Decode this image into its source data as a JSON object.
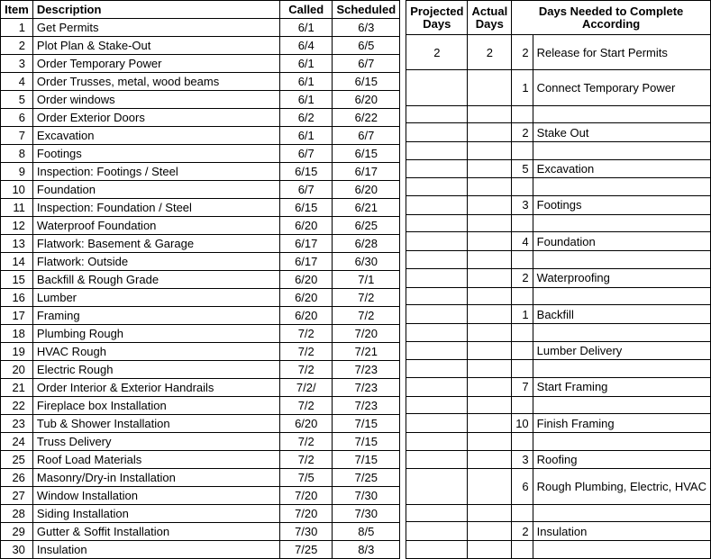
{
  "left": {
    "headers": {
      "item": "Item",
      "desc": "Description",
      "called": "Called",
      "scheduled": "Scheduled"
    },
    "rows": [
      {
        "item": "1",
        "desc": "Get Permits",
        "called": "6/1",
        "scheduled": "6/3"
      },
      {
        "item": "2",
        "desc": "Plot Plan & Stake-Out",
        "called": "6/4",
        "scheduled": "6/5"
      },
      {
        "item": "3",
        "desc": "Order Temporary Power",
        "called": "6/1",
        "scheduled": "6/7"
      },
      {
        "item": "4",
        "desc": "Order Trusses, metal, wood beams",
        "called": "6/1",
        "scheduled": "6/15"
      },
      {
        "item": "5",
        "desc": "Order windows",
        "called": "6/1",
        "scheduled": "6/20"
      },
      {
        "item": "6",
        "desc": "Order Exterior Doors",
        "called": "6/2",
        "scheduled": "6/22"
      },
      {
        "item": "7",
        "desc": "Excavation",
        "called": "6/1",
        "scheduled": "6/7"
      },
      {
        "item": "8",
        "desc": "Footings",
        "called": "6/7",
        "scheduled": "6/15"
      },
      {
        "item": "9",
        "desc": "Inspection: Footings / Steel",
        "called": "6/15",
        "scheduled": "6/17"
      },
      {
        "item": "10",
        "desc": "Foundation",
        "called": "6/7",
        "scheduled": "6/20"
      },
      {
        "item": "11",
        "desc": "Inspection: Foundation / Steel",
        "called": "6/15",
        "scheduled": "6/21"
      },
      {
        "item": "12",
        "desc": "Waterproof Foundation",
        "called": "6/20",
        "scheduled": "6/25"
      },
      {
        "item": "13",
        "desc": "Flatwork: Basement & Garage",
        "called": "6/17",
        "scheduled": "6/28"
      },
      {
        "item": "14",
        "desc": "Flatwork: Outside",
        "called": "6/17",
        "scheduled": "6/30"
      },
      {
        "item": "15",
        "desc": "Backfill & Rough Grade",
        "called": "6/20",
        "scheduled": "7/1"
      },
      {
        "item": "16",
        "desc": "Lumber",
        "called": "6/20",
        "scheduled": "7/2"
      },
      {
        "item": "17",
        "desc": "Framing",
        "called": "6/20",
        "scheduled": "7/2"
      },
      {
        "item": "18",
        "desc": "Plumbing Rough",
        "called": "7/2",
        "scheduled": "7/20"
      },
      {
        "item": "19",
        "desc": "HVAC Rough",
        "called": "7/2",
        "scheduled": "7/21"
      },
      {
        "item": "20",
        "desc": "Electric Rough",
        "called": "7/2",
        "scheduled": "7/23"
      },
      {
        "item": "21",
        "desc": "Order Interior & Exterior Handrails",
        "called": "7/2/",
        "scheduled": "7/23"
      },
      {
        "item": "22",
        "desc": "Fireplace box Installation",
        "called": "7/2",
        "scheduled": "7/23"
      },
      {
        "item": "23",
        "desc": "Tub & Shower Installation",
        "called": "6/20",
        "scheduled": "7/15"
      },
      {
        "item": "24",
        "desc": "Truss Delivery",
        "called": "7/2",
        "scheduled": "7/15"
      },
      {
        "item": "25",
        "desc": "Roof Load Materials",
        "called": "7/2",
        "scheduled": "7/15"
      },
      {
        "item": "26",
        "desc": "Masonry/Dry-in Installation",
        "called": "7/5",
        "scheduled": "7/25"
      },
      {
        "item": "27",
        "desc": "Window Installation",
        "called": "7/20",
        "scheduled": "7/30"
      },
      {
        "item": "28",
        "desc": "Siding Installation",
        "called": "7/20",
        "scheduled": "7/30"
      },
      {
        "item": "29",
        "desc": "Gutter & Soffit Installation",
        "called": "7/30",
        "scheduled": "8/5"
      },
      {
        "item": "30",
        "desc": "Insulation",
        "called": "7/25",
        "scheduled": "8/3"
      }
    ]
  },
  "right": {
    "headers": {
      "projected": "Projected Days",
      "actual": "Actual Days",
      "daysNeeded": "Days Needed to Complete According"
    },
    "rows": [
      {
        "span": 2,
        "proj": "2",
        "actual": "2",
        "daysn": "2",
        "note": "Release for Start Permits"
      },
      {
        "span": 2,
        "proj": "",
        "actual": "",
        "daysn": "1",
        "note": "Connect Temporary Power"
      },
      {
        "span": 1,
        "proj": "",
        "actual": "",
        "daysn": "",
        "note": ""
      },
      {
        "span": 1,
        "proj": "",
        "actual": "",
        "daysn": "2",
        "note": "Stake Out"
      },
      {
        "span": 1,
        "proj": "",
        "actual": "",
        "daysn": "",
        "note": ""
      },
      {
        "span": 1,
        "proj": "",
        "actual": "",
        "daysn": "5",
        "note": "Excavation"
      },
      {
        "span": 1,
        "proj": "",
        "actual": "",
        "daysn": "",
        "note": ""
      },
      {
        "span": 1,
        "proj": "",
        "actual": "",
        "daysn": "3",
        "note": "Footings"
      },
      {
        "span": 1,
        "proj": "",
        "actual": "",
        "daysn": "",
        "note": ""
      },
      {
        "span": 1,
        "proj": "",
        "actual": "",
        "daysn": "4",
        "note": "Foundation"
      },
      {
        "span": 1,
        "proj": "",
        "actual": "",
        "daysn": "",
        "note": ""
      },
      {
        "span": 1,
        "proj": "",
        "actual": "",
        "daysn": "2",
        "note": "Waterproofing"
      },
      {
        "span": 1,
        "proj": "",
        "actual": "",
        "daysn": "",
        "note": ""
      },
      {
        "span": 1,
        "proj": "",
        "actual": "",
        "daysn": "1",
        "note": "Backfill"
      },
      {
        "span": 1,
        "proj": "",
        "actual": "",
        "daysn": "",
        "note": ""
      },
      {
        "span": 1,
        "proj": "",
        "actual": "",
        "daysn": "",
        "note": "Lumber Delivery"
      },
      {
        "span": 1,
        "proj": "",
        "actual": "",
        "daysn": "",
        "note": ""
      },
      {
        "span": 1,
        "proj": "",
        "actual": "",
        "daysn": "7",
        "note": "Start Framing"
      },
      {
        "span": 1,
        "proj": "",
        "actual": "",
        "daysn": "",
        "note": ""
      },
      {
        "span": 1,
        "proj": "",
        "actual": "",
        "daysn": "10",
        "note": "Finish Framing"
      },
      {
        "span": 1,
        "proj": "",
        "actual": "",
        "daysn": "",
        "note": ""
      },
      {
        "span": 1,
        "proj": "",
        "actual": "",
        "daysn": "3",
        "note": "Roofing"
      },
      {
        "span": 2,
        "proj": "",
        "actual": "",
        "daysn": "6",
        "note": "Rough Plumbing, Electric, HVAC"
      },
      {
        "span": 1,
        "proj": "",
        "actual": "",
        "daysn": "",
        "note": ""
      },
      {
        "span": 1,
        "proj": "",
        "actual": "",
        "daysn": "2",
        "note": "Insulation"
      },
      {
        "span": 1,
        "proj": "",
        "actual": "",
        "daysn": "",
        "note": ""
      }
    ]
  }
}
